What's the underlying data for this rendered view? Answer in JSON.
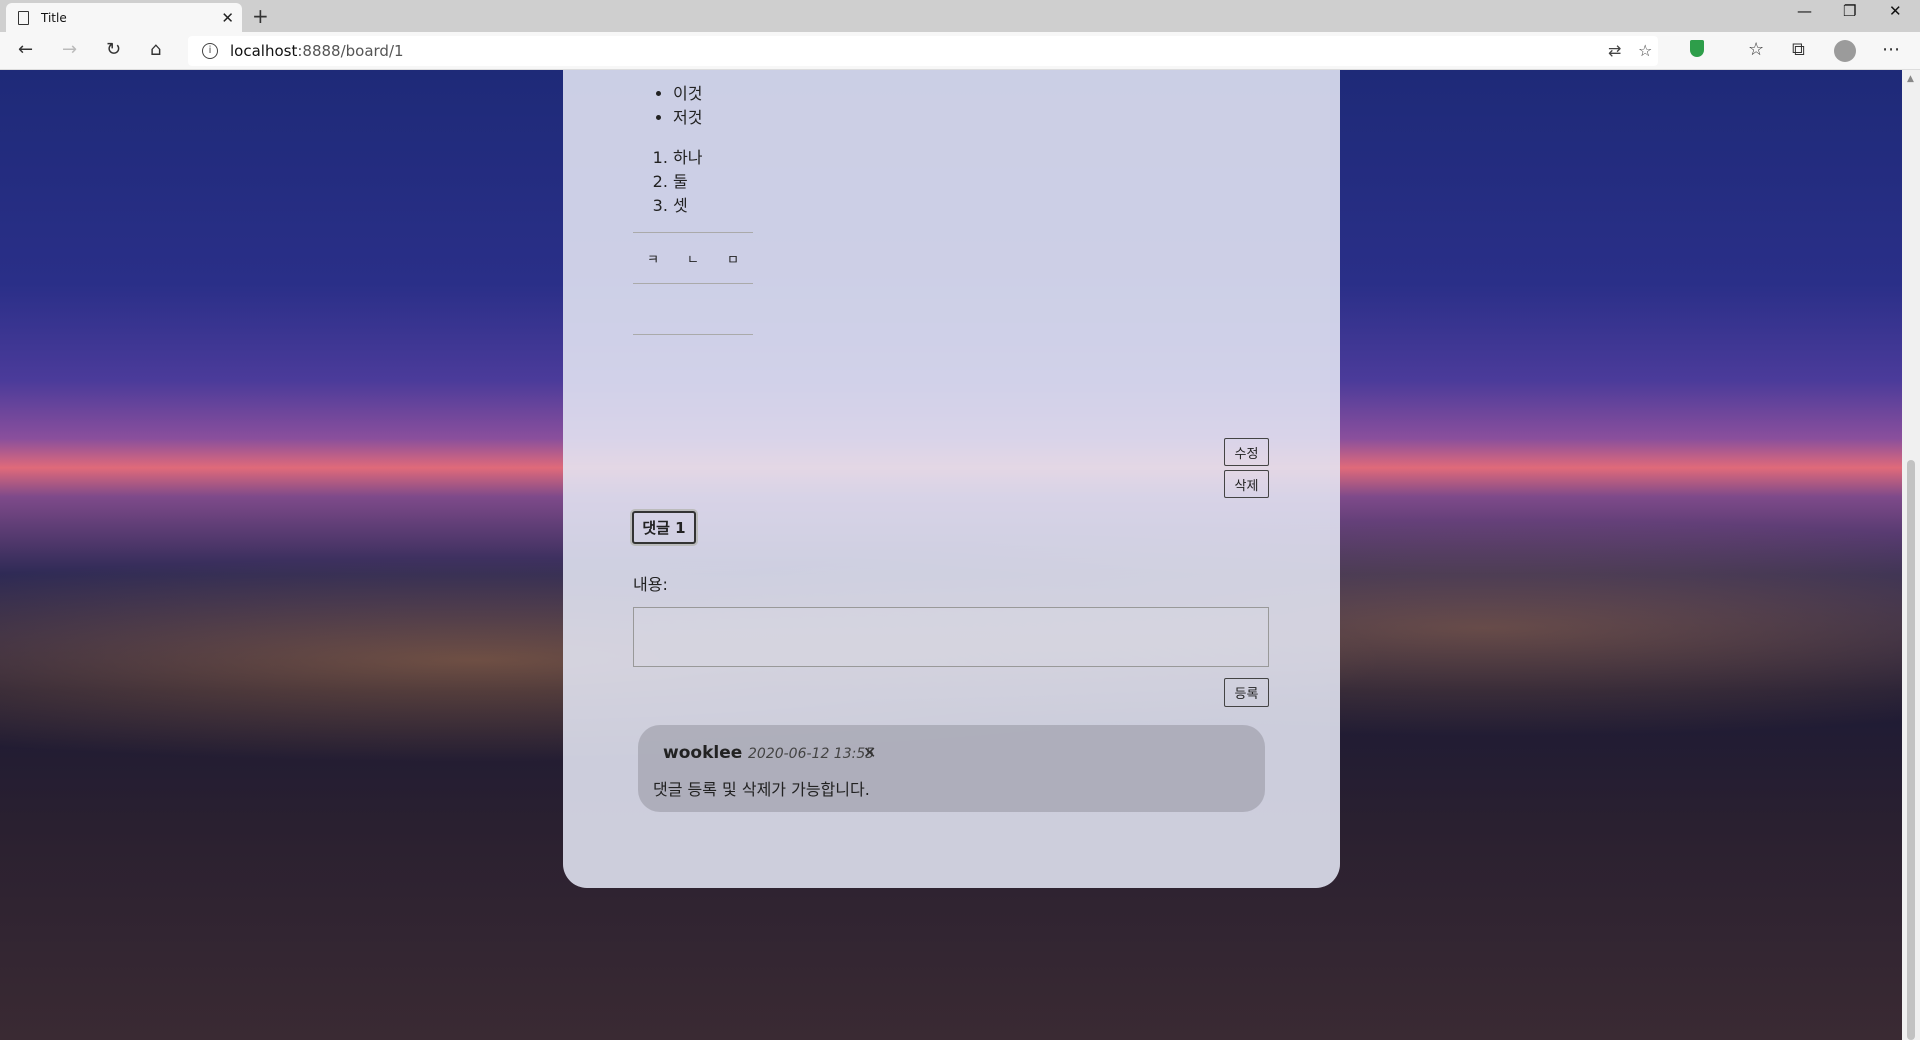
{
  "browser": {
    "tab_title": "Title",
    "url_host": "localhost",
    "url_rest": ":8888/board/1"
  },
  "post": {
    "bullets": [
      "이것",
      "저것"
    ],
    "numbered": [
      "하나",
      "둘",
      "셋"
    ],
    "table_cells": [
      "ㅋ",
      "ㄴ",
      "ㅁ"
    ],
    "edit_label": "수정",
    "delete_label": "삭제"
  },
  "comments": {
    "toggle_label": "댓글 1",
    "content_label": "내용:",
    "submit_label": "등록",
    "items": [
      {
        "author": "wooklee",
        "date": "2020-06-12 13:55",
        "delete_icon": "✕",
        "text": "댓글 등록 및 삭제가 가능합니다."
      }
    ]
  }
}
